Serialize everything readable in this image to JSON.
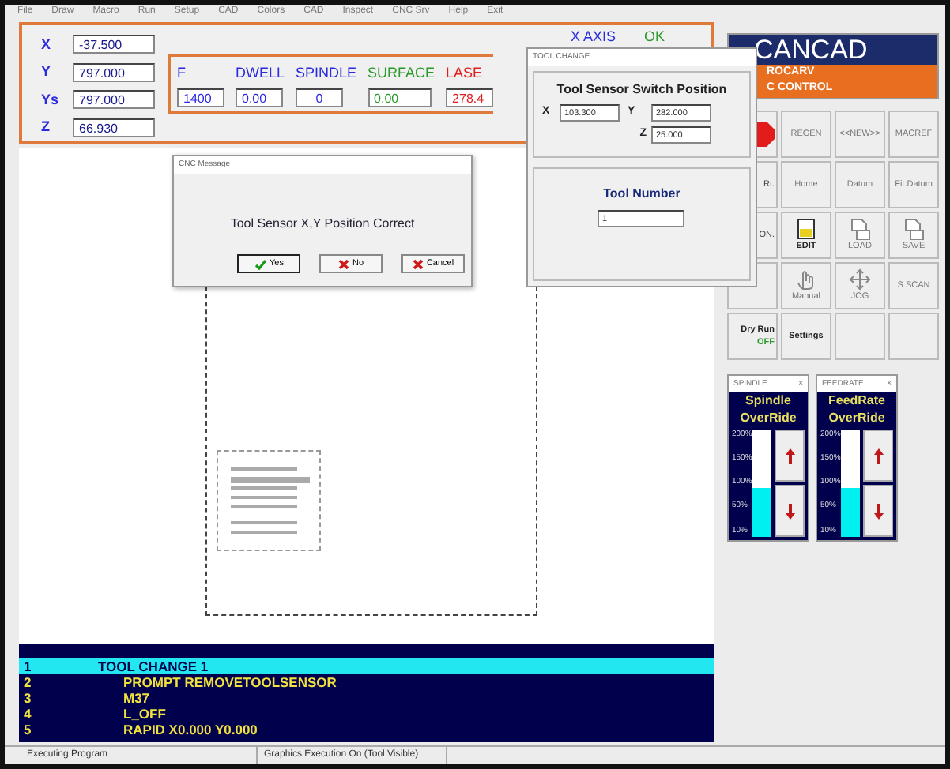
{
  "menu": [
    "File",
    "Draw",
    "Macro",
    "Run",
    "Setup",
    "CAD",
    "Colors",
    "CAD",
    "Inspect",
    "CNC Srv",
    "Help",
    "Exit"
  ],
  "axes": [
    {
      "label": "X",
      "value": "-37.500"
    },
    {
      "label": "Y",
      "value": "797.000"
    },
    {
      "label": "Ys",
      "value": "797.000"
    },
    {
      "label": "Z",
      "value": "66.930"
    }
  ],
  "params": [
    {
      "label": "F",
      "value": "1400",
      "color": "#2a2ae0"
    },
    {
      "label": "DWELL",
      "value": "0.00",
      "color": "#2a2ae0"
    },
    {
      "label": "SPINDLE",
      "value": "0",
      "color": "#2a2ae0"
    },
    {
      "label": "SURFACE",
      "value": "0.00",
      "color": "#2a9a2a"
    },
    {
      "label": "LASE",
      "value": "278.4",
      "color": "#e02020"
    }
  ],
  "axis_status": {
    "axis": "X AXIS",
    "status": "OK"
  },
  "logo": {
    "title": "CANCAD",
    "subtitle": "ROCARV",
    "tagline": "C CONTROL"
  },
  "buttons": [
    {
      "kind": "stop"
    },
    {
      "kind": "text",
      "label": "REGEN"
    },
    {
      "kind": "text",
      "label": "<<NEW>>"
    },
    {
      "kind": "text",
      "label": "MACREF"
    },
    {
      "kind": "text",
      "label": "Rt."
    },
    {
      "kind": "text",
      "label": "Home"
    },
    {
      "kind": "text",
      "label": "Datum"
    },
    {
      "kind": "text",
      "label": "Fit.Datum"
    },
    {
      "kind": "text",
      "label": "ON."
    },
    {
      "kind": "edit",
      "label": "EDIT"
    },
    {
      "kind": "load",
      "label": "LOAD"
    },
    {
      "kind": "load",
      "label": "SAVE"
    },
    {
      "kind": "blank"
    },
    {
      "kind": "hand",
      "label": "Manual"
    },
    {
      "kind": "jog",
      "label": "JOG"
    },
    {
      "kind": "text",
      "label": "S SCAN"
    },
    {
      "kind": "dry",
      "label": "Dry Run",
      "sub": "OFF"
    },
    {
      "kind": "text",
      "label": "Settings"
    },
    {
      "kind": "blank"
    },
    {
      "kind": "blank"
    }
  ],
  "message_dialog": {
    "title": "CNC Message",
    "text": "Tool Sensor X,Y Position Correct",
    "buttons": [
      {
        "label": "Yes",
        "kind": "yes"
      },
      {
        "label": "No",
        "kind": "no"
      },
      {
        "label": "Cancel",
        "kind": "no"
      }
    ]
  },
  "tool_change_dialog": {
    "title": "TOOL CHANGE",
    "heading": "Tool Sensor Switch Position",
    "fields": [
      {
        "label": "X",
        "value": "103.300"
      },
      {
        "label": "Y",
        "value": "282.000"
      },
      {
        "label": "Z",
        "value": "25.000"
      }
    ],
    "tool_number_label": "Tool Number",
    "tool_number": "1"
  },
  "overrides": [
    {
      "title": "SPINDLE",
      "close": "×",
      "heading": "Spindle",
      "heading2": "OverRide",
      "scale": [
        "200%",
        "150%",
        "100%",
        "50%",
        "10%"
      ],
      "level": 0.45
    },
    {
      "title": "FEEDRATE",
      "close": "×",
      "heading": "FeedRate",
      "heading2": "OverRide",
      "scale": [
        "200%",
        "150%",
        "100%",
        "50%",
        "10%"
      ],
      "level": 0.45
    }
  ],
  "program": [
    {
      "number": "1",
      "code": "TOOL CHANGE 1",
      "selected": true,
      "children": [
        {
          "number": "2",
          "code": "PROMPT REMOVETOOLSENSOR",
          "selected": false
        },
        {
          "number": "3",
          "code": "M37",
          "selected": false
        },
        {
          "number": "4",
          "code": "L_OFF",
          "selected": false
        },
        {
          "number": "5",
          "code": "RAPID X0.000 Y0.000",
          "selected": false
        }
      ]
    }
  ],
  "status_bar": [
    "Executing Program",
    "Graphics Execution On (Tool Visible)"
  ]
}
